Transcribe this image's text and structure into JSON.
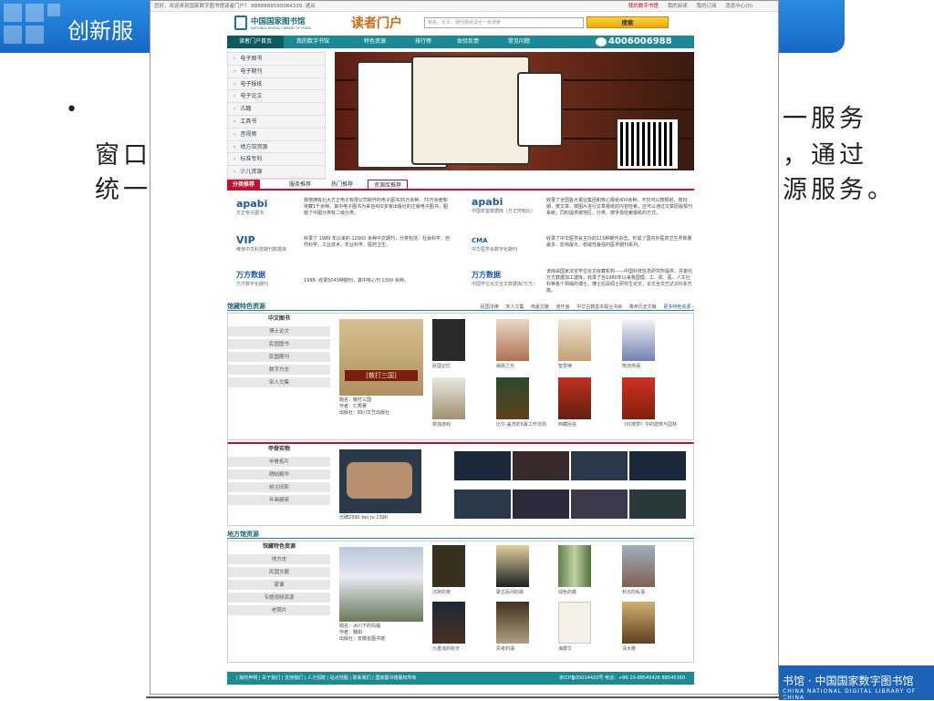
{
  "slide": {
    "title": "创新服",
    "bullet": "•",
    "text_right1": "一服务",
    "text_row2_left": "窗口",
    "text_row2_right": "，通过",
    "text_row3_left": "统一",
    "text_row3_right": "源服务。",
    "footer_cn": "书馆 · 中国国家数字图书馆",
    "footer_en": "CHINA NATIONAL DIGITAL LIBRARY OF CHINA"
  },
  "topbar": {
    "left": "您好，欢迎来到国家数字图书馆读者门户！ 8888888590084339, 退出",
    "right": [
      "我的数字书馆",
      "我的阅读",
      "我的订阅",
      "消息中心(0)"
    ]
  },
  "logo": {
    "cn": "中国国家图书馆",
    "en": "NATIONAL DIGITAL LIBRARY OF CHINA"
  },
  "portal_title": "读者门户",
  "search": {
    "placeholder": "题名、论文、期刊报纸请全一步搜索",
    "button": "搜索"
  },
  "nav": [
    "读者门户首页",
    "我的数字书馆",
    "特色资源",
    "排行榜",
    "体验反馈",
    "常见问题"
  ],
  "phone": "4006006988",
  "sidebar": [
    "电子图书",
    "电子期刊",
    "电子报纸",
    "电子论文",
    "古籍",
    "工具书",
    "音视频",
    "地方馆资源",
    "标准专利",
    "少儿资源"
  ],
  "tabs": [
    "分类推荐",
    "服务推荐",
    "热门推荐",
    "资源库推荐"
  ],
  "resources": [
    {
      "logo": "apabi",
      "cap": "方正电子图书",
      "desc": "我馆拥有北大方正电子有限公司制作的电子图书35万余种、70万余册和常藏1千余种。其中电子图书为来自400多家出版社的正版电子图书；图题了中图分类有二级分类。"
    },
    {
      "logo": "apabi",
      "cap": "中国年鉴数据库（方正阿帕比）",
      "desc": "收录了全国各大报业集团和核心报纸400余种，不仅可以按报纸、按日期、按文章、按图片进行文章报纸的内容检索，还可以通过文章原版报刊系统，同时提供按地区、分类、按字母检索报纸的方式。"
    },
    {
      "logo": "VIP",
      "cap": "维普中文科技期刊数据库",
      "desc": "收录了 1989 年以来的 12000 余种中文期刊，分类包括：社会科学、自然科学、工业技术、农业科学、医药卫生。"
    },
    {
      "logo": "CMA",
      "cap": "中华医学会数字化期刊",
      "desc": "收录了中华医学会主办的115种期刊杂志，形成了国内外医药卫生界数量最多、影响最大、权威性最强的医学期刊系列。"
    },
    {
      "logo": "万方数据",
      "cap": "万方数字化期刊",
      "desc": "1998- 收录5043种期刊，其中核心刊 1300 余种。"
    },
    {
      "logo": "万方数据",
      "cap": "中国学位论文全文数据库(万方)",
      "desc": "该库由国家法定学位论文收藏机构——中国科技信息研究所提供，并委托万方数据加工建库，收录了自1980年以来我国理、工、农、医、人文社科等各个领域的博士、博士后及硕士研究生论文，论文全文已达200多万篇。"
    }
  ],
  "sections": {
    "special": {
      "title": "馆藏特色资源",
      "links": [
        "民国法律",
        "宋人文集",
        "西夏文献",
        "连环画",
        "中华古籍善本联合书目",
        "革命历史文献",
        "更多特色资源 ›"
      ],
      "menu_head": "中文图书",
      "menu": [
        "博士论文",
        "民国图书",
        "民国期刊",
        "数字方志",
        "宋人文集"
      ],
      "feature": {
        "title": "题名：散打三国",
        "author": "作者：仁秀著",
        "pub": "出版社：四川文艺出版社",
        "cover_text": "[散打三国]"
      },
      "books": [
        "民国记忆",
        "闽晨之光",
        "智慧律",
        "物流简语",
        "数独游戏",
        "比尔·盖茨的5幕工作法则",
        "西藏民俗",
        "《红楼梦》中的建筑与园林"
      ]
    },
    "oracle": {
      "menu_head": "甲骨实物",
      "menu": [
        "甲骨拓片",
        "碑帖精华",
        "前尘旧影",
        "年画撷英"
      ],
      "caption": "元碑2390 bei tu 2390"
    },
    "local": {
      "title": "地方馆资源",
      "menu_head": "馆藏特色资源",
      "menu": [
        "地方志",
        "民国文献",
        "家谱",
        "专题视频资源",
        "老照片"
      ],
      "feature": {
        "title": "题名：冰川下的玛瑙",
        "author": "作者：魏如",
        "pub": "出版社：安徽省图书馆"
      },
      "books": [
        "沉默的夜",
        "蒙古民间的歌",
        "绿色的森",
        "秋日的私语",
        "九重浅的秋天",
        "思考的湖",
        "海康文",
        "清水雅"
      ]
    }
  },
  "footer": {
    "left": "| 版权声明 | 关于我们 | 支持我们 | 人才招聘 | 站点地图 | 联系我们 | 国家图书馆版权所有",
    "right": "京ICP备05014420号 电话：+86-10-88545426 88545360"
  }
}
